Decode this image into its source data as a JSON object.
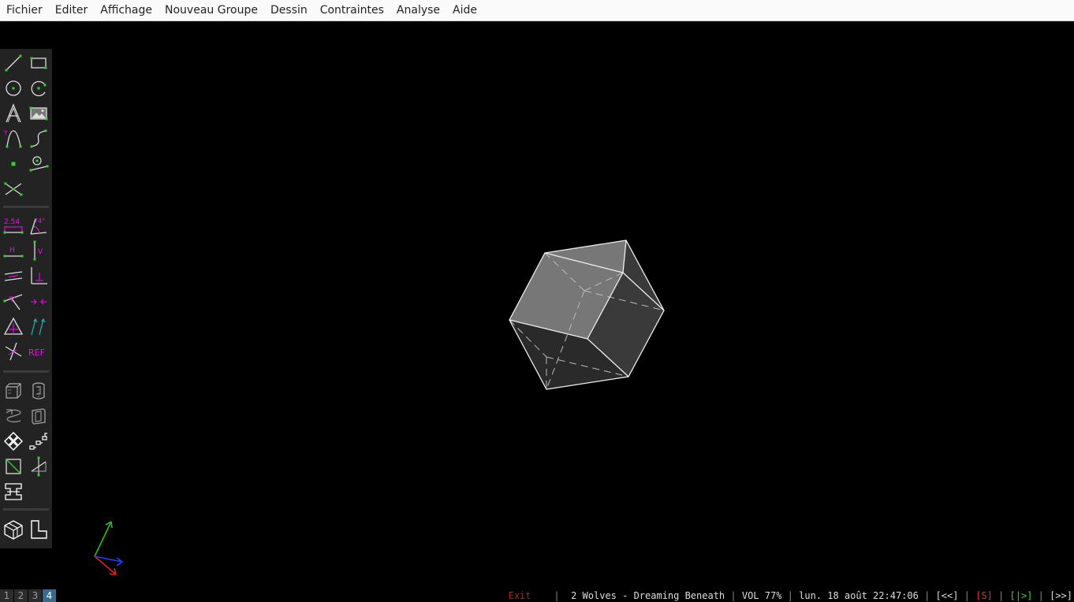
{
  "menu": {
    "items": [
      "Fichier",
      "Editer",
      "Affichage",
      "Nouveau Groupe",
      "Dessin",
      "Contraintes",
      "Analyse",
      "Aide"
    ]
  },
  "toolbar": {
    "dimension_label": "2.54",
    "angle_label": "74°",
    "horizontal_label": "H",
    "vertical_label": "V",
    "reference_label": "REF"
  },
  "colors": {
    "menu_bg": "#fafafa",
    "toolbar_bg": "#232323",
    "sketch_green": "#33cc33",
    "constraint_magenta": "#ff00ff",
    "axis_x": "#e02020",
    "axis_y": "#20c020",
    "axis_z": "#2040ff"
  },
  "statusbar": {
    "workspaces": [
      "1",
      "2",
      "3",
      "4"
    ],
    "active_workspace": "4",
    "exit": "Exit",
    "music": "2 Wolves - Dreaming Beneath",
    "volume": "VOL 77%",
    "datetime": "lun. 18 août 22:47:06",
    "btn_prev": "[<<]",
    "btn_stop": "[S]",
    "btn_play": "[|>]",
    "btn_next": "[>>]"
  }
}
